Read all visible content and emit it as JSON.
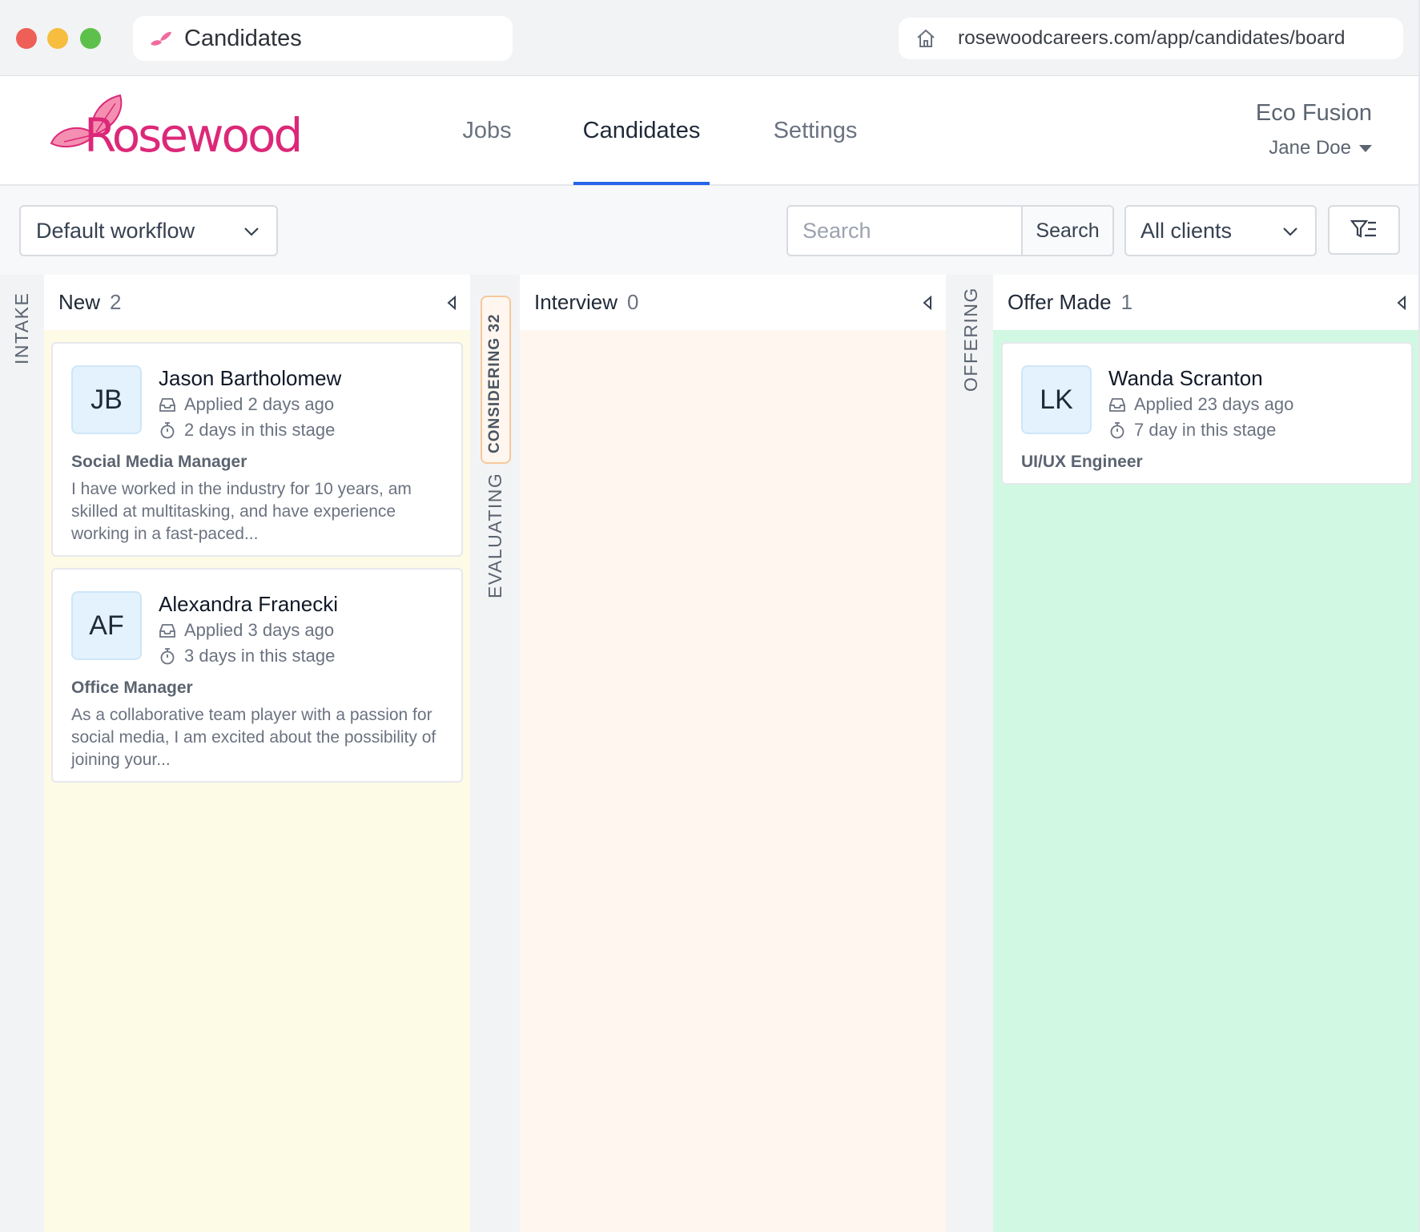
{
  "browser": {
    "tab_title": "Candidates",
    "url": "rosewoodcareers.com/app/candidates/board"
  },
  "brand": {
    "logo_text": "Rosewood",
    "accent_color": "#dc2878"
  },
  "nav": {
    "items": [
      {
        "label": "Jobs",
        "active": false
      },
      {
        "label": "Candidates",
        "active": true
      },
      {
        "label": "Settings",
        "active": false
      }
    ],
    "active_underline_color": "#2563eb"
  },
  "account": {
    "company": "Eco Fusion",
    "user": "Jane Doe"
  },
  "toolbar": {
    "workflow_value": "Default workflow",
    "search_placeholder": "Search",
    "search_button": "Search",
    "clients_value": "All clients",
    "filter_icon": "filter-list-icon"
  },
  "board": {
    "groups": [
      {
        "label": "INTAKE"
      },
      {
        "label": "EVALUATING"
      },
      {
        "label": "OFFERING"
      }
    ],
    "collapsed_stage": {
      "label": "CONSIDERING 32"
    },
    "columns": [
      {
        "title": "New",
        "count": "2",
        "color": "#fdfae6",
        "cards": [
          {
            "initials": "JB",
            "name": "Jason Bartholomew",
            "applied": "Applied 2 days ago",
            "stage_time": "2 days in this stage",
            "role": "Social Media Manager",
            "summary": "I have worked in the industry for 10 years, am skilled at multitasking, and have experience working in a fast-paced..."
          },
          {
            "initials": "AF",
            "name": "Alexandra Franecki",
            "applied": "Applied 3 days ago",
            "stage_time": "3 days in this stage",
            "role": "Office Manager",
            "summary": "As a collaborative team player with a passion for social media, I am excited about the possibility of joining your..."
          }
        ]
      },
      {
        "title": "Interview",
        "count": "0",
        "color": "#fef6ef",
        "cards": []
      },
      {
        "title": "Offer Made",
        "count": "1",
        "color": "#d1f8e3",
        "cards": [
          {
            "initials": "LK",
            "name": "Wanda Scranton",
            "applied": "Applied 23 days ago",
            "stage_time": "7 day in this stage",
            "role": "UI/UX Engineer",
            "summary": ""
          }
        ]
      }
    ]
  }
}
